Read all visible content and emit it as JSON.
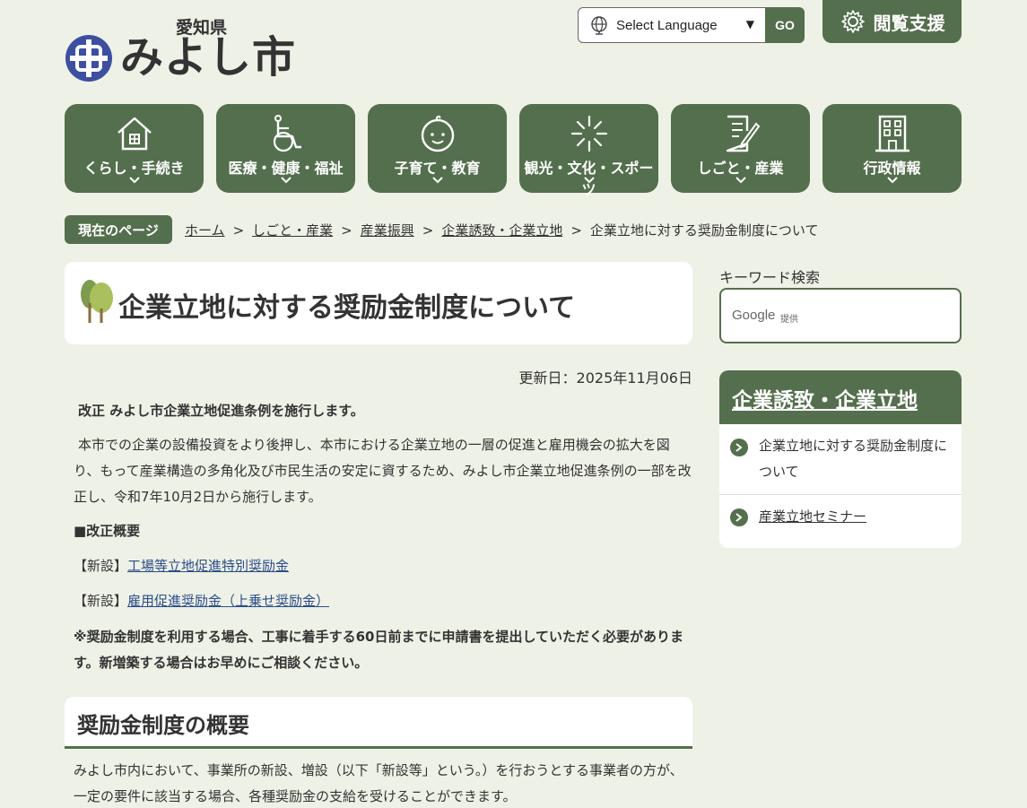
{
  "header": {
    "prefecture": "愛知県",
    "city": "みよし市",
    "language_select": "Select Language",
    "go_label": "GO",
    "assist_label": "閲覧支援"
  },
  "nav": [
    {
      "label": "くらし・手続き",
      "icon": "house-icon"
    },
    {
      "label": "医療・健康・福祉",
      "icon": "wheelchair-icon"
    },
    {
      "label": "子育て・教育",
      "icon": "child-face-icon"
    },
    {
      "label": "観光・文化・スポーツ",
      "icon": "fireworks-icon"
    },
    {
      "label": "しごと・産業",
      "icon": "document-pen-icon"
    },
    {
      "label": "行政情報",
      "icon": "building-icon"
    }
  ],
  "breadcrumb": {
    "badge": "現在のページ",
    "items": [
      "ホーム",
      "しごと・産業",
      "産業振興",
      "企業誘致・企業立地"
    ],
    "current": "企業立地に対する奨励金制度について"
  },
  "page": {
    "title": "企業立地に対する奨励金制度について",
    "updated": "更新日：2025年11月06日",
    "intro_heading": "改正 みよし市企業立地促進条例を施行します。",
    "intro_body": "本市での企業の設備投資をより後押し、本市における企業立地の一層の促進と雇用機会の拡大を図り、もって産業構造の多角化及び市民生活の安定に資するため、みよし市企業立地促進条例の一部を改正し、令和7年10月2日から施行します。",
    "outline_heading": "■改正概要",
    "new_items": [
      {
        "prefix": "【新設】",
        "link": "工場等立地促進特別奨励金"
      },
      {
        "prefix": "【新設】",
        "link": "雇用促進奨励金（上乗せ奨励金）"
      }
    ],
    "note": "※奨励金制度を利用する場合、工事に着手する60日前までに申請書を提出していただく必要があります。新増築する場合はお早めにご相談ください。",
    "section_title": "奨励金制度の概要",
    "section_body": "みよし市内において、事業所の新設、増設（以下「新設等」という。）を行おうとする事業者の方が、一定の要件に該当する場合、各種奨励金の支給を受けることができます。"
  },
  "sidebar": {
    "keyword_label": "キーワード検索",
    "google_label": "Google",
    "provided_label": "提供",
    "category_title": "企業誘致・企業立地",
    "links": [
      {
        "label": "企業立地に対する奨励金制度について",
        "current": true
      },
      {
        "label": "産業立地セミナー",
        "current": false
      }
    ]
  },
  "colors": {
    "accent": "#546f4d",
    "background": "#eef1e6",
    "link": "#2b4d8a",
    "emblem": "#3d4fa0"
  }
}
